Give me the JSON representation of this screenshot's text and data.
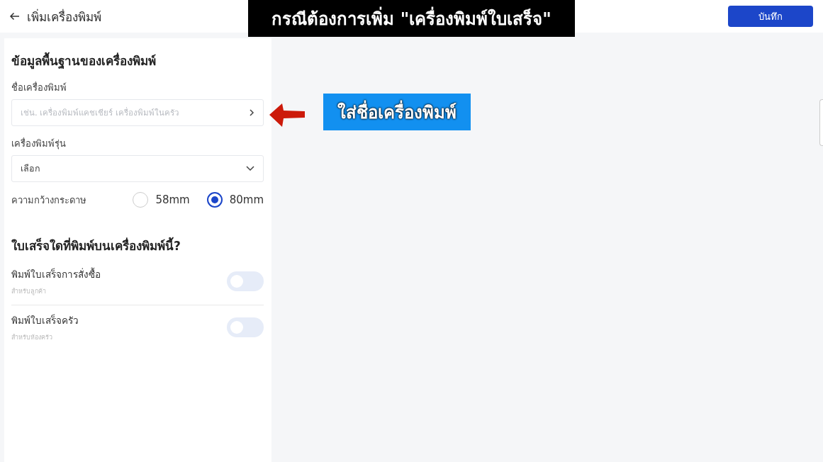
{
  "header": {
    "title": "เพิ่มเครื่องพิมพ์",
    "save_button": "บันทึก"
  },
  "basic_info": {
    "heading": "ข้อมูลพื้นฐานของเครื่องพิมพ์",
    "name_field": {
      "label": "ชื่อเครื่องพิมพ์",
      "placeholder": "เช่น. เครื่องพิมพ์แคชเชียร์ เครื่องพิมพ์ในครัว"
    },
    "model_field": {
      "label": "เครื่องพิมพ์รุ่น",
      "value": "เลือก"
    },
    "paper_width": {
      "label": "ความกว้างกระดาษ",
      "options": [
        {
          "label": "58mm",
          "selected": false
        },
        {
          "label": "80mm",
          "selected": true
        }
      ]
    }
  },
  "receipts": {
    "heading": "ใบเสร็จใดที่พิมพ์บนเครื่องพิมพ์นี้?",
    "items": [
      {
        "title": "พิมพ์ใบเสร็จการสั่งซื้อ",
        "subtitle": "สำหรับลูกค้า",
        "on": false
      },
      {
        "title": "พิมพ์ใบเสร็จครัว",
        "subtitle": "สำหรับห้องครัว",
        "on": false
      }
    ]
  },
  "captions": {
    "top": "กรณีต้องการเพิ่ม \"เครื่องพิมพ์ใบเสร็จ\"",
    "hint": "ใส่ชื่อเครื่องพิมพ์"
  }
}
